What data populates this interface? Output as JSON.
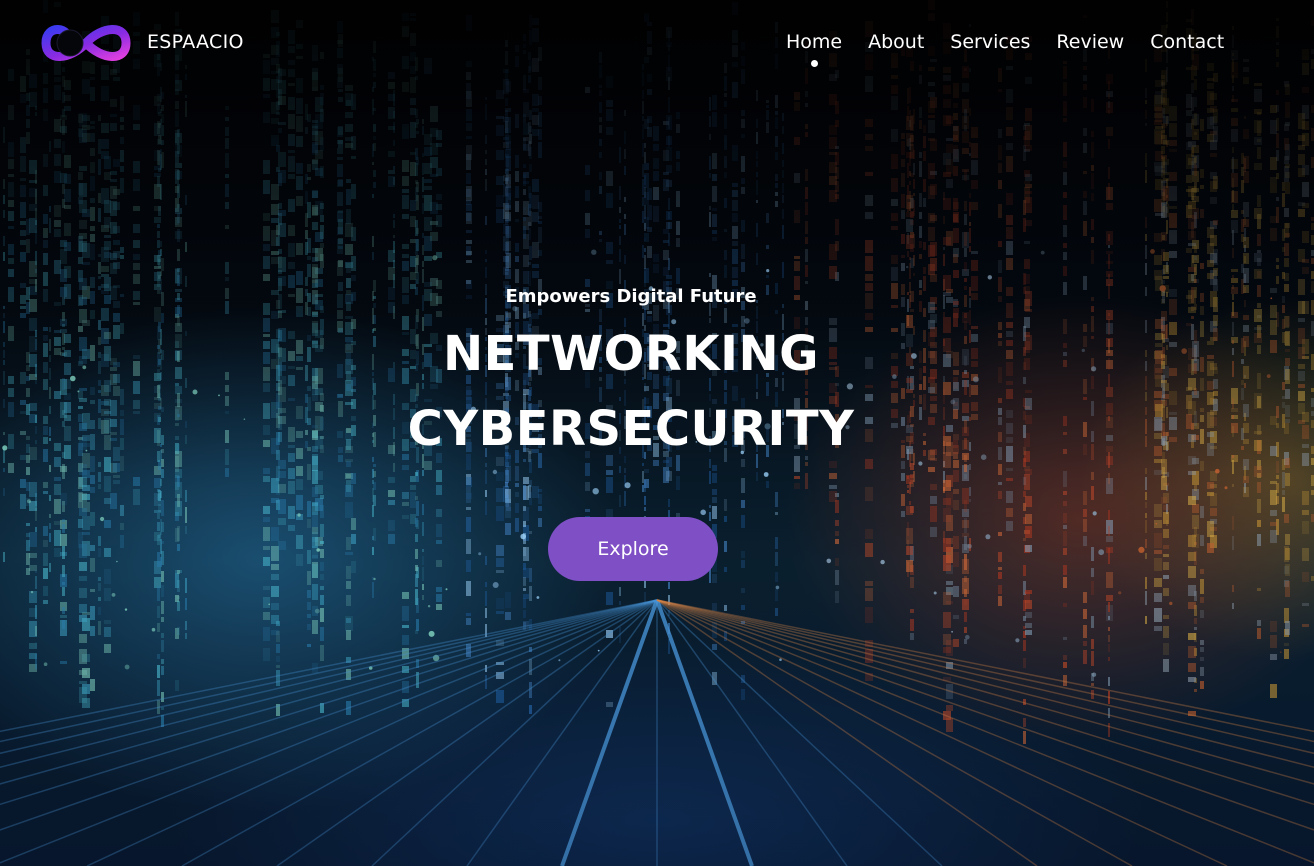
{
  "navbar": {
    "logo_icon": "infinity-logo-icon",
    "brand": "ESPAACIO",
    "links": [
      {
        "label": "Home",
        "active": true
      },
      {
        "label": "About",
        "active": false
      },
      {
        "label": "Services",
        "active": false
      },
      {
        "label": "Review",
        "active": false
      },
      {
        "label": "Contact",
        "active": false
      }
    ]
  },
  "hero": {
    "subtitle": "Empowers Digital Future",
    "title_line_1": "NETWORKING",
    "title_line_2": "CYBERSECURITY",
    "cta_label": "Explore",
    "background": "digital-data-streams-image"
  },
  "colors": {
    "accent": "#7f4fc6",
    "text": "#ffffff",
    "logo_gradient_start": "#3b3bf0",
    "logo_gradient_end": "#d23ad6"
  }
}
